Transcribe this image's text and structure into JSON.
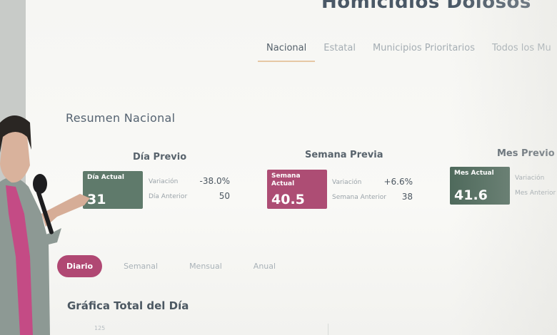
{
  "header": {
    "title": "Homicidios Dolosos"
  },
  "tabs": [
    {
      "label": "Nacional",
      "active": true
    },
    {
      "label": "Estatal"
    },
    {
      "label": "Municipios Prioritarios"
    },
    {
      "label": "Todos los Mu"
    }
  ],
  "summary": {
    "title": "Resumen Nacional",
    "cards": [
      {
        "heading": "Día Previo",
        "box_label": "Día Actual",
        "box_value": "31",
        "color": "#5f7a6b",
        "rows": [
          {
            "label": "Variación",
            "value": "-38.0%"
          },
          {
            "label": "Día Anterior",
            "value": "50"
          }
        ]
      },
      {
        "heading": "Semana Previa",
        "box_label": "Semana Actual",
        "box_value": "40.5",
        "color": "#ad4d74",
        "rows": [
          {
            "label": "Variación",
            "value": "+6.6%"
          },
          {
            "label": "Semana Anterior",
            "value": "38"
          }
        ]
      },
      {
        "heading": "Mes Previo",
        "box_label": "Mes Actual",
        "box_value": "41.6",
        "color": "#4f6a5c",
        "rows": [
          {
            "label": "Variación",
            "value": ""
          },
          {
            "label": "Mes Anterior",
            "value": ""
          }
        ]
      }
    ]
  },
  "period_tabs": [
    {
      "label": "Diario",
      "active": true
    },
    {
      "label": "Semanal"
    },
    {
      "label": "Mensual"
    },
    {
      "label": "Anual"
    }
  ],
  "chart": {
    "title": "Gráfica Total del Día",
    "first_tick": "125"
  },
  "colors": {
    "accent_pink": "#b04873",
    "tab_underline": "#e6c8a4",
    "box_green": "#5f7a6b",
    "box_pink": "#ad4d74"
  }
}
